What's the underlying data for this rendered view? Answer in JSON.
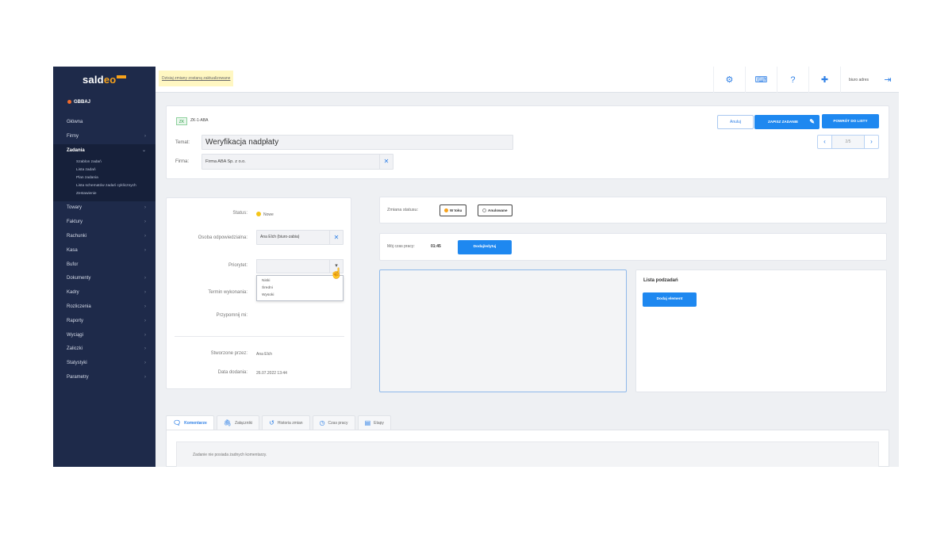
{
  "sidebar": {
    "logo_main": "sald",
    "logo_accent": "eo",
    "company": "GBBAJ",
    "items": [
      {
        "label": "Główna",
        "chevron": false
      },
      {
        "label": "Firmy",
        "chevron": true
      },
      {
        "label": "Zadania",
        "chevron": true,
        "active": true
      }
    ],
    "subitems": [
      "Szablon zadań",
      "Lista zadań",
      "Plan zadania",
      "Lista schematów zadań cyklicznych",
      "Zestawienie"
    ],
    "items_after": [
      {
        "label": "Towary"
      },
      {
        "label": "Faktury"
      },
      {
        "label": "Rachunki"
      },
      {
        "label": "Kasa"
      },
      {
        "label": "Bufor"
      },
      {
        "label": "Dokumenty"
      },
      {
        "label": "Kadry"
      },
      {
        "label": "Rozliczenia"
      },
      {
        "label": "Raporty"
      },
      {
        "label": "Wyciągi"
      },
      {
        "label": "Zaliczki"
      },
      {
        "label": "Statystyki"
      },
      {
        "label": "Parametry"
      }
    ]
  },
  "topbar": {
    "notice": "Dzisiaj zmiany zostaną zaktualizowane",
    "user": "biuro adres",
    "icons": [
      "group-settings-icon",
      "keyboard-icon",
      "help-icon",
      "support-icon"
    ]
  },
  "task": {
    "code_badge": "ZK",
    "code_text": "ZK-1-ABA",
    "subject_label": "Temat:",
    "subject": "Weryfikacja nadpłaty",
    "company_label": "Firma:",
    "company": "Firma ABA Sp. z o.o.",
    "btn_cancel": "Anuluj",
    "btn_save": "ZAPISZ ZADANIE",
    "btn_back": "POWRÓT DO LISTY",
    "pager_text": "2/5"
  },
  "details": {
    "status_label": "Status:",
    "status_value": "Nowe",
    "owner_label": "Osoba odpowiedzialna:",
    "owner_value": "Ana Elch (biuro-zabia)",
    "priority_label": "Priorytet:",
    "priority_options": [
      "Niski",
      "Średni",
      "Wysoki"
    ],
    "deadline_label": "Termin wykonania:",
    "reminder_label": "Przypomnij mi:",
    "created_by_label": "Stworzone przez:",
    "created_by_value": "Ana Elch",
    "created_date_label": "Data dodania:",
    "created_date_value": "26.07.2022 13:44"
  },
  "status_change": {
    "label": "Zmiana statusu:",
    "options": [
      {
        "label": "W toku",
        "color": "#f7a21b"
      },
      {
        "label": "Anulowane",
        "color": "#bbbbbb"
      }
    ]
  },
  "time": {
    "label": "Mój czas pracy:",
    "value": "01:45",
    "button": "Dodaj/edytuj"
  },
  "subtasks": {
    "title": "Lista podzadań",
    "button": "Dodaj element"
  },
  "tabs": {
    "items": [
      {
        "label": "Komentarze",
        "icon": "comments-icon",
        "glyph": "🗨",
        "active": true
      },
      {
        "label": "Załączniki",
        "icon": "attachment-icon",
        "glyph": "🖇"
      },
      {
        "label": "Historia zmian",
        "icon": "history-icon",
        "glyph": "↺"
      },
      {
        "label": "Czas pracy",
        "icon": "clock-icon",
        "glyph": "◷"
      },
      {
        "label": "Etapy",
        "icon": "stages-icon",
        "glyph": "▤"
      }
    ],
    "empty_comments": "Zadanie nie posiada żadnych komentarzy."
  }
}
